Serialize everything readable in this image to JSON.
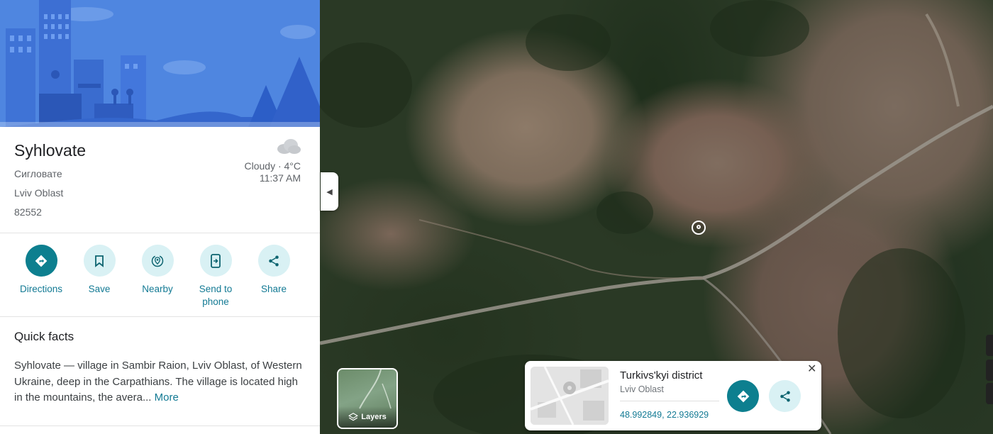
{
  "place": {
    "name": "Syhlovate",
    "local_name": "Сигловате",
    "region": "Lviv Oblast",
    "postal_code": "82552"
  },
  "weather": {
    "icon": "cloud-icon",
    "condition": "Cloudy · 4°C",
    "time": "11:37 AM"
  },
  "actions": [
    {
      "label": "Directions",
      "icon": "directions-icon",
      "primary": true
    },
    {
      "label": "Save",
      "icon": "bookmark-icon",
      "primary": false
    },
    {
      "label": "Nearby",
      "icon": "nearby-icon",
      "primary": false
    },
    {
      "label": "Send to phone",
      "icon": "send-to-phone-icon",
      "primary": false
    },
    {
      "label": "Share",
      "icon": "share-icon",
      "primary": false
    }
  ],
  "quick_facts": {
    "title": "Quick facts",
    "text": "Syhlovate — village in Sambir Raion, Lviv Oblast, of Western Ukraine, deep in the Carpathians. The village is located high in the mountains, the avera...",
    "more_label": "More"
  },
  "map": {
    "layers_label": "Layers",
    "card": {
      "title": "Turkivs'kyi district",
      "subtitle": "Lviv Oblast",
      "coordinates": "48.992849, 22.936929"
    }
  },
  "colors": {
    "accent": "#0d7f8f",
    "accent_light": "#d9f1f4",
    "link": "#137a94",
    "hero_sky": "#4f86e0"
  }
}
